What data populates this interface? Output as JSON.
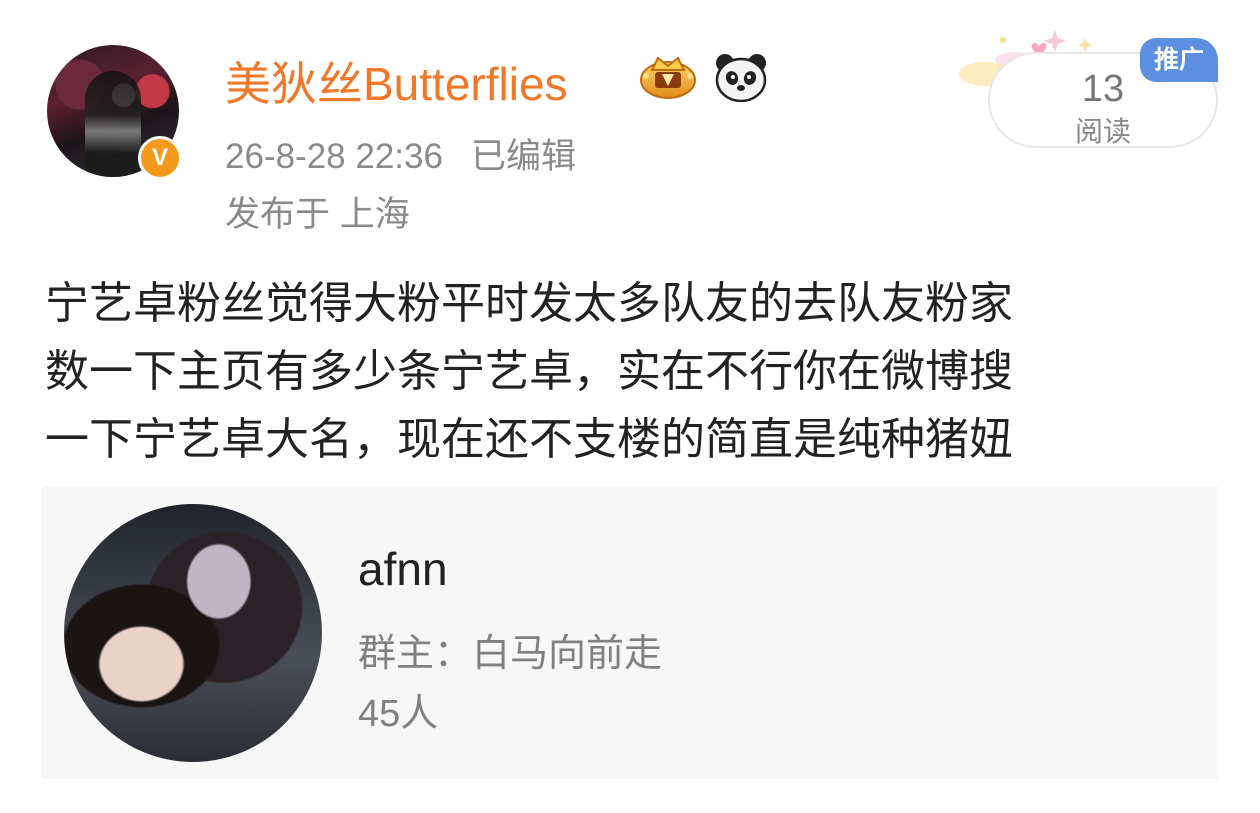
{
  "post": {
    "author": "美狄丝Butterflies",
    "timestamp": "26-8-28 22:36",
    "edited_label": "已编辑",
    "location": "发布于 上海",
    "read_count": "13",
    "read_label": "阅读",
    "promo_label": "推广",
    "body_lines": [
      "宁艺卓粉丝觉得大粉平时发太多队友的去队友粉家",
      "数一下主页有多少条宁艺卓，实在不行你在微博搜",
      "一下宁艺卓大名，现在还不支楼的简直是纯种猪妞"
    ]
  },
  "group_card": {
    "name": "afnn",
    "owner": "群主：白马向前走",
    "member_count": "45人"
  },
  "icons": {
    "verified": "verified-badge-icon",
    "crown": "crown-icon",
    "panda": "panda-icon",
    "sparkles": "sparkles-icon"
  },
  "colors": {
    "username": "#f0782a",
    "verified_badge": "#f39a1c",
    "promo_badge": "#5c8fe0",
    "meta_text": "#8a8a8a",
    "card_bg": "#f7f7f7"
  }
}
